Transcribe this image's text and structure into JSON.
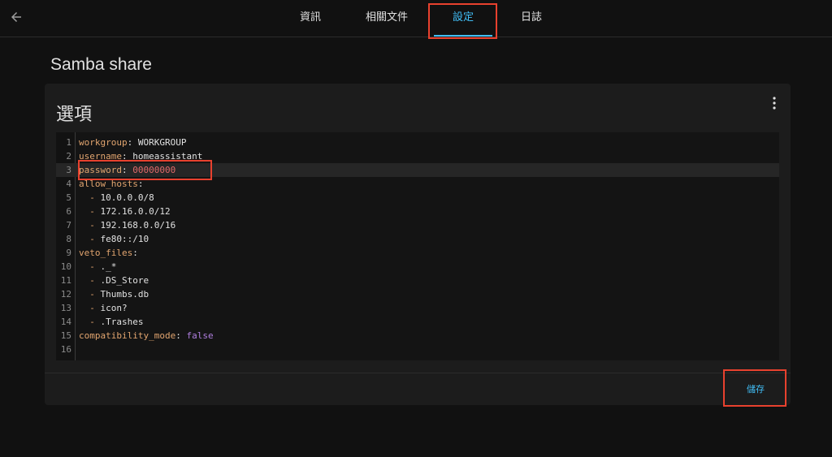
{
  "header": {
    "tabs": [
      {
        "label": "資訊"
      },
      {
        "label": "相關文件"
      },
      {
        "label": "設定",
        "active": true
      },
      {
        "label": "日誌"
      }
    ],
    "back_icon": "arrow-left-icon"
  },
  "page": {
    "title": "Samba share"
  },
  "card": {
    "title": "選項",
    "menu_icon": "dots-vertical-icon",
    "save_label": "儲存"
  },
  "editor": {
    "lines": [
      {
        "n": "1",
        "key": "workgroup",
        "sep": ": ",
        "val": "WORKGROUP"
      },
      {
        "n": "2",
        "key": "username",
        "sep": ": ",
        "val": "homeassistant"
      },
      {
        "n": "3",
        "key": "password",
        "sep": ": ",
        "val": "00000000"
      },
      {
        "n": "4",
        "key": "allow_hosts",
        "sep": ":",
        "val": ""
      },
      {
        "n": "5",
        "dash": "- ",
        "val": "10.0.0.0/8"
      },
      {
        "n": "6",
        "dash": "- ",
        "val": "172.16.0.0/12"
      },
      {
        "n": "7",
        "dash": "- ",
        "val": "192.168.0.0/16"
      },
      {
        "n": "8",
        "dash": "- ",
        "val": "fe80::/10"
      },
      {
        "n": "9",
        "key": "veto_files",
        "sep": ":",
        "val": ""
      },
      {
        "n": "10",
        "dash": "- ",
        "val": "._*"
      },
      {
        "n": "11",
        "dash": "- ",
        "val": ".DS_Store"
      },
      {
        "n": "12",
        "dash": "- ",
        "val": "Thumbs.db"
      },
      {
        "n": "13",
        "dash": "- ",
        "val": "icon?"
      },
      {
        "n": "14",
        "dash": "- ",
        "val": ".Trashes"
      },
      {
        "n": "15",
        "key": "compatibility_mode",
        "sep": ": ",
        "val": "false"
      },
      {
        "n": "16",
        "val": ""
      }
    ]
  },
  "colors": {
    "accent": "#41bdf5",
    "annotation": "#e8412e",
    "key": "#e2a56f",
    "number": "#e26a6a",
    "boolean": "#b07fe0"
  }
}
